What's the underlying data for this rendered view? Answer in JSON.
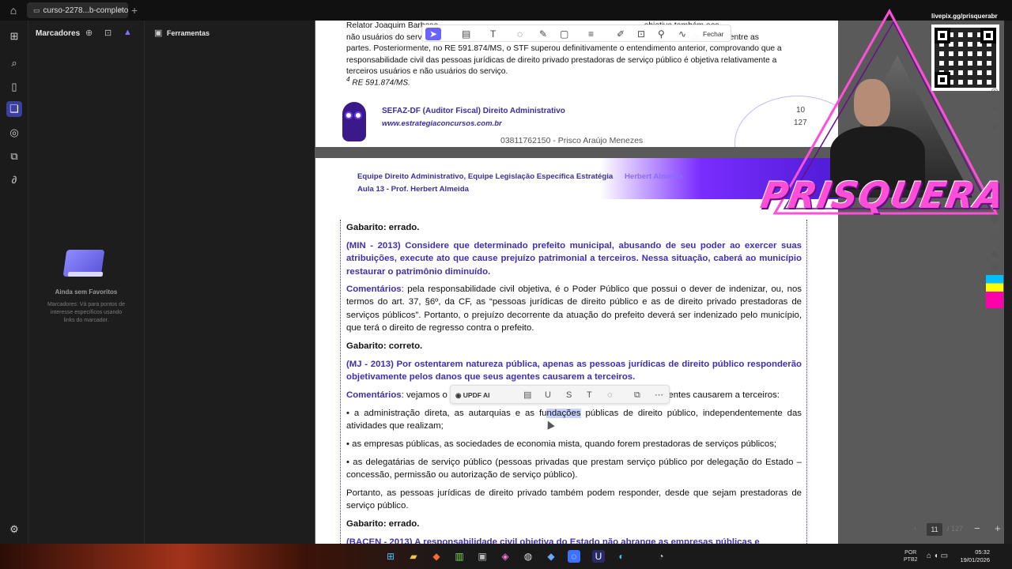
{
  "tabbar": {
    "tab_title": "curso-2278...b-completo",
    "add_symbol": "+"
  },
  "left_rail": {
    "icons": [
      "home-icon",
      "grid-icon",
      "search-icon",
      "page-icon",
      "bookmark-icon",
      "comment-icon",
      "layers-icon",
      "attachment-icon",
      "settings-icon"
    ]
  },
  "bookmarks_panel": {
    "title": "Marcadores",
    "empty_title": "Ainda sem Favoritos",
    "empty_desc": "Marcadores: Vá para pontos de interesse específicos usando links do marcador."
  },
  "tools_panel": {
    "title": "Ferramentas"
  },
  "floating_toolbar": {
    "close_label": "Fechar"
  },
  "page1": {
    "paragraph": "Relator Joaquim Barbosa ... não usuários do serviço ... partes. Posteriormente, no RE 591.874/MS, o STF superou definitivamente o entendimento anterior, comprovando que a responsabilidade civil das pessoas jurídicas de direito privado prestadoras de serviço público é objetiva relativamente a terceiros usuários e não usuários do serviço.",
    "line1": "Relator Joaquim Barbosa",
    "line1_end": "objetiva também aos",
    "line2_start": "não usuários do serv",
    "line2_end": "de acordo entre as",
    "line3": "partes. Posteriormente, no RE 591.874/MS, o STF superou definitivamente o entendimento anterior, comprovando que a",
    "line4": "responsabilidade civil das pessoas jurídicas de direito privado prestadoras de serviço público é objetiva relativamente a",
    "line5": "terceiros usuários e não usuários do serviço.",
    "footnote_sup": "4",
    "footnote": "RE 591.874/MS.",
    "header_title": "SEFAZ-DF (Auditor Fiscal) Direito Administrativo",
    "header_url": "www.estrategiaconcursos.com.br",
    "page_num": "10",
    "page_total": "127",
    "cpf_line": "03811762150 - Prisco Araújo Menezes"
  },
  "page2": {
    "band_line1": "Equipe Direito Administrativo, Equipe Legislação Específica Estratégia",
    "band_line1_tail": "Herbert Almeida",
    "band_line2": "Aula 13 - Prof. Herbert Almeida",
    "gabarito1": "Gabarito: errado.",
    "q1": "(MIN - 2013) Considere que determinado prefeito municipal, abusando de seu poder ao exercer suas atribuições, execute ato que cause prejuízo patrimonial a terceiros. Nessa situação, caberá ao município restaurar o patrimônio diminuído.",
    "c1_label": "Comentários",
    "c1": ": pela responsabilidade civil objetiva, é o Poder Público que possui o dever de indenizar, ou, nos termos do art. 37, §6º, da CF, as “pessoas jurídicas de direito público e as de direito privado prestadoras de serviços públicos”. Portanto, o prejuízo decorrente da atuação do prefeito deverá ser indenizado pelo município, que terá o direito de regresso contra o prefeito.",
    "gabarito2": "Gabarito: correto.",
    "q2": "(MJ - 2013) Por ostentarem natureza pública, apenas as pessoas jurídicas de direito público responderão objetivamente pelos danos que seus agentes causarem a terceiros.",
    "c2_label": "Comentários",
    "c2_start": ": vejamos o",
    "c2_end": "s agentes causarem a terceiros:",
    "bullet1_a": "• a administração direta, as autarquias e as fu",
    "bullet1_hl": "ndações",
    "bullet1_b": " públicas de direito público, independentemente das atividades que realizam;",
    "bullet2": "• as empresas públicas, as sociedades de economia mista, quando forem prestadoras de serviços públicos;",
    "bullet3": "• as delegatárias de serviço público (pessoas privadas que prestam serviço público por delegação do Estado – concessão, permissão ou autorização de serviço público).",
    "conclusion": "Portanto, as pessoas jurídicas de direito privado também podem responder, desde que sejam prestadoras de serviço público.",
    "gabarito3": "Gabarito: errado.",
    "q3_partial": "(BACEN - 2013) A responsabilidade civil objetiva do Estado não abrange as empresas públicas e"
  },
  "selection_toolbar": {
    "ai_label": "UPDF AI"
  },
  "overlay": {
    "live_url": "livepix.gg/prisquerabr",
    "logo": "PRISQUERA"
  },
  "pager": {
    "current": "11",
    "total": "/ 127",
    "zoom_out": "−",
    "zoom_in": "+"
  },
  "taskbar": {
    "lang_top": "POR",
    "lang_bottom": "PTB2",
    "time": "05:32",
    "date": "19/01/2026"
  }
}
